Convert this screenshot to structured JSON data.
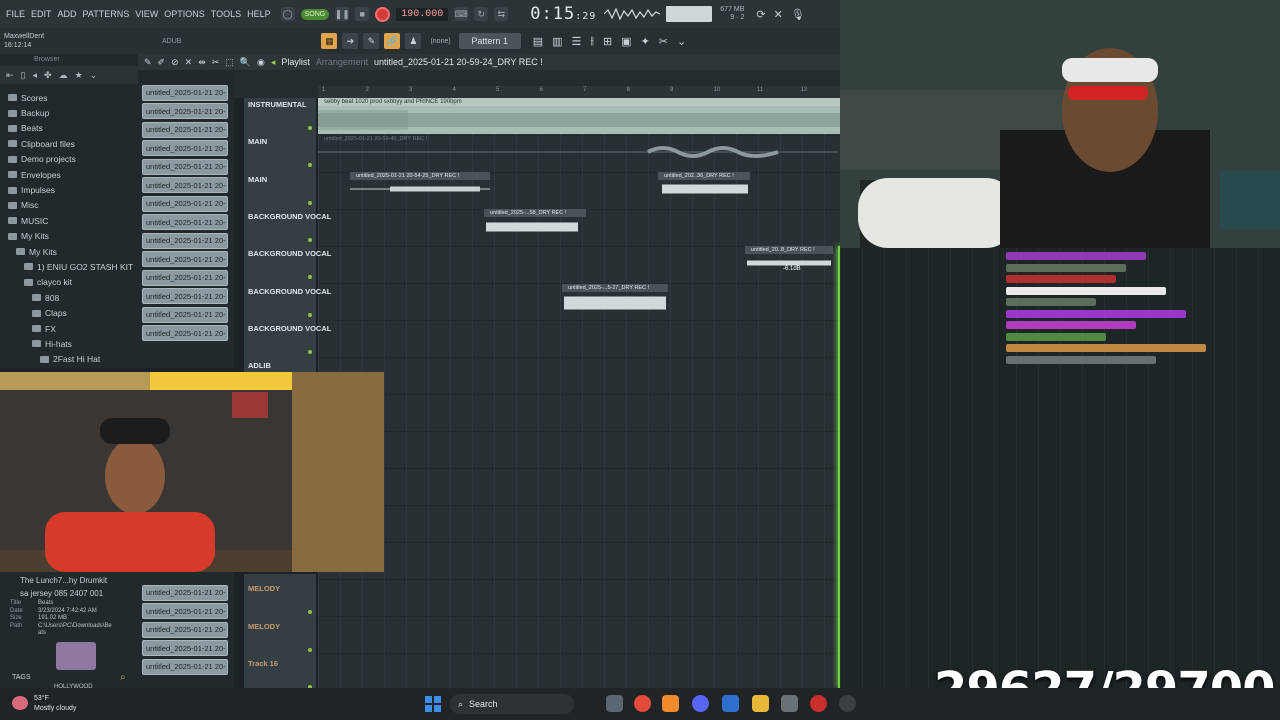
{
  "menu": [
    "FILE",
    "EDIT",
    "ADD",
    "PATTERNS",
    "VIEW",
    "OPTIONS",
    "TOOLS",
    "HELP"
  ],
  "transport": {
    "song_mode": "SONG",
    "tempo": "190.000",
    "time_main": "0:15",
    "time_sub": ":29"
  },
  "cpu": {
    "mem": "677 MB",
    "poly": "9",
    "cpu_val": "2"
  },
  "hint": {
    "line1": "MaxwellDent",
    "line2": "16:12:14"
  },
  "mode_label": "ADUB",
  "none_label": "(none)",
  "pattern_select": "Pattern 1",
  "browser": {
    "header": "Browser",
    "items": [
      {
        "label": "Scores",
        "indent": 0
      },
      {
        "label": "Backup",
        "indent": 0
      },
      {
        "label": "Beats",
        "indent": 0
      },
      {
        "label": "Clipboard files",
        "indent": 0
      },
      {
        "label": "Demo projects",
        "indent": 0
      },
      {
        "label": "Envelopes",
        "indent": 0
      },
      {
        "label": "Impulses",
        "indent": 0
      },
      {
        "label": "Misc",
        "indent": 0
      },
      {
        "label": "MUSIC",
        "indent": 0
      },
      {
        "label": "My Kits",
        "indent": 0
      },
      {
        "label": "My Kits",
        "indent": 1
      },
      {
        "label": "1) ENIU GO2 STASH KIT",
        "indent": 2
      },
      {
        "label": "clayco kit",
        "indent": 2
      },
      {
        "label": "808",
        "indent": 3
      },
      {
        "label": "Claps",
        "indent": 3
      },
      {
        "label": "FX",
        "indent": 3
      },
      {
        "label": "Hi-hats",
        "indent": 3
      },
      {
        "label": "2Fast Hi Hat",
        "indent": 4
      }
    ]
  },
  "files_top": [
    "untitled_2025-01-21 20-",
    "untitled_2025-01-21 20-",
    "untitled_2025-01-21 20-",
    "untitled_2025-01-21 20-",
    "untitled_2025-01-21 20-",
    "untitled_2025-01-21 20-",
    "untitled_2025-01-21 20-",
    "untitled_2025-01-21 20-",
    "untitled_2025-01-21 20-",
    "untitled_2025-01-21 20-",
    "untitled_2025-01-21 20-",
    "untitled_2025-01-21 20-",
    "untitled_2025-01-21 20-",
    "untitled_2025-01-21 20-"
  ],
  "files_bottom": [
    "untitled_2025-01-21 20-",
    "untitled_2025-01-21 20-",
    "untitled_2025-01-21 20-",
    "untitled_2025-01-21 20-",
    "untitled_2025-01-21 20-"
  ],
  "playlist": {
    "title": "Playlist",
    "sub": "Arrangement",
    "project": "untitled_2025-01-21 20-59-24_DRY REC !"
  },
  "ruler": [
    "1",
    "2",
    "3",
    "4",
    "5",
    "6",
    "7",
    "8",
    "9",
    "10",
    "11",
    "12"
  ],
  "tracks": [
    "INSTRUMENTAL",
    "MAIN",
    "MAIN",
    "BACKGROUND VOCAL",
    "BACKGROUND VOCAL",
    "BACKGROUND VOCAL",
    "BACKGROUND VOCAL",
    "ADLIB"
  ],
  "lower_tracks": [
    "MELODY",
    "MELODY",
    "Track 16"
  ],
  "clips": {
    "instrumental": "sebby beat 1020 prod sxbbyy and PRINCE 190bpm",
    "main_a": "untitled_2025-01-21 20-59-40_DRY REC !",
    "c1": "untitled_2025-01-21 20-54-25_DRY REC !",
    "c2": "untitled_202..36_DRY REC !",
    "c3": "untitled_2025-...58_DRY REC !",
    "c4": "untitled_20..8_DRY REC !",
    "c4_gain": "-6.1dB",
    "c5": "untitled_2025-...5-27_DRY REC !"
  },
  "lower_browser": {
    "items": [
      "The Lunch7...hy Drumkit",
      "sa jersey 085 2407 001"
    ],
    "meta": [
      {
        "k": "Title",
        "v": "Beats"
      },
      {
        "k": "Date",
        "v": "3/23/2024 7:42:42 AM"
      },
      {
        "k": "Size",
        "v": "191.02 MB"
      },
      {
        "k": "Path",
        "v": "C:\\Users\\PC\\Downloads\\Be"
      },
      {
        "k": "",
        "v": "ats"
      }
    ],
    "tags": "TAGS",
    "logo_text": "HOLLYWOOD"
  },
  "counter": "29627/29700",
  "taskbar": {
    "temp": "53°F",
    "weather": "Mostly cloudy",
    "search": "Search"
  },
  "colors": {
    "playhead": "#6fd23a",
    "record": "#d43c3c",
    "accent": "#e0a54a"
  }
}
